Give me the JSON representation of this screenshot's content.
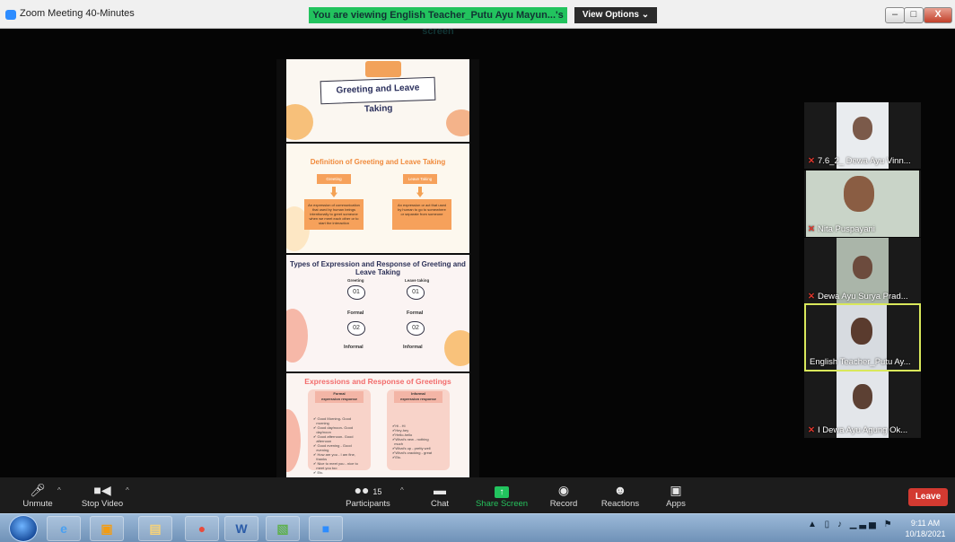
{
  "window": {
    "title": "Zoom Meeting 40-Minutes",
    "share_banner": "You are viewing English Teacher_Putu Ayu Mayun...'s screen",
    "view_options": "View Options ⌄",
    "controls": {
      "minimize": "–",
      "maximize": "□",
      "close": "X"
    }
  },
  "slides": {
    "slide1_title": "Greeting and Leave Taking",
    "slide2_title": "Definition of Greeting and Leave Taking",
    "slide2_left_box": "Greeting",
    "slide2_right_box": "Leave Taking",
    "slide2_left_def": "An expression of communication that used by human beings intentionally to greet someone when we meet each other or to start the interaction",
    "slide2_right_def": "An expression or act that used by human to go to somewhere or separate from someone",
    "slide3_title": "Types of Expression and Response of Greeting and Leave Taking",
    "slide3_col1": "Greeting",
    "slide3_col2": "Leave taking",
    "num1": "01",
    "num2": "02",
    "formal": "Formal",
    "informal": "Informal",
    "slide4_title": "Expressions and Response of Greetings",
    "slide4_left_head": "Formal\nexpression response",
    "slide4_right_head": "Informal\nexpression response",
    "slide4_left_list": "✔ Good Morning- Good\n   morning\n✔ Good day/noon- Good\n   day/noon\n✔ Good afternoon- Good\n   afternoon\n✔ Good evening - Good\n   evening\n✔ How are you - I am fine,\n   thanks\n✔ Nice to meet you - nice to\n   meet you too\n✔ Etc.",
    "slide4_right_list": "✔Hi - Hi\n✔Hey-hey\n✔Hello-hello\n✔What's new - nothing\n  much\n✔What's up - pretty well\n✔What's cracking - great\n✔Etc."
  },
  "participants": [
    {
      "name": "7.6_2_ Dewa Ayu Vinn...",
      "muted": true,
      "active": false
    },
    {
      "name": "Nita Puspayani",
      "muted": true,
      "active": false
    },
    {
      "name": "Dewa Ayu Surya Prad...",
      "muted": true,
      "active": false
    },
    {
      "name": "English Teacher_Putu Ay...",
      "muted": false,
      "active": true
    },
    {
      "name": "I Dewa Ayu Agung Ok...",
      "muted": true,
      "active": false
    }
  ],
  "toolbar": {
    "unmute": "Unmute",
    "stop_video": "Stop Video",
    "participants": "Participants",
    "participants_count": "15",
    "chat": "Chat",
    "share_screen": "Share Screen",
    "record": "Record",
    "reactions": "Reactions",
    "apps": "Apps",
    "leave": "Leave"
  },
  "taskbar": {
    "time": "9:11 AM",
    "date": "10/18/2021",
    "apps": [
      "internet-explorer-icon",
      "outlook-icon",
      "file-explorer-icon",
      "chrome-icon",
      "word-icon",
      "photo-viewer-icon",
      "zoom-icon"
    ]
  },
  "colors": {
    "share_green": "#22c35e",
    "leave_red": "#d33a31",
    "active_speaker": "#d9e85b",
    "zoom_blue": "#2d8cff"
  }
}
